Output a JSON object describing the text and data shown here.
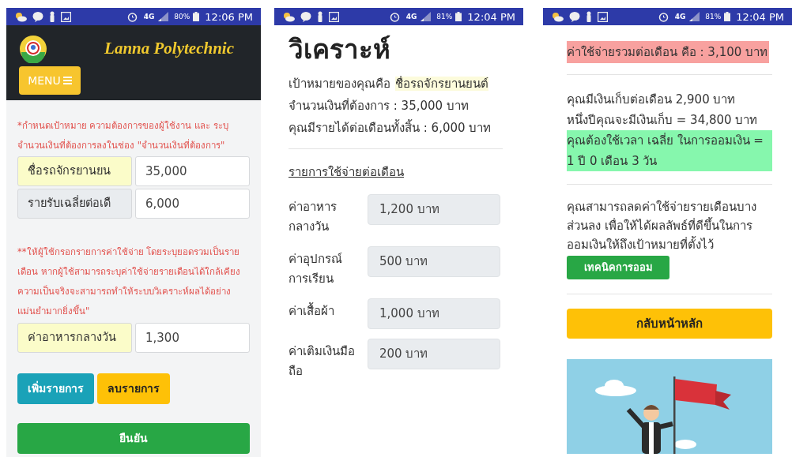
{
  "left_screen": {
    "status_bar": {
      "network": "4G",
      "battery": "80%",
      "time": "12:06 PM"
    },
    "header": {
      "title": "Lanna Polytechnic",
      "menu_button": "MENU"
    },
    "goal_note": "*กำหนดเป้าหมาย ความต้องการของผู้ใช้งาน และ ระบุจำนวนเงินที่ต้องการลงในช่อง \"จำนวนเงินที่ต้องการ\"",
    "goal_inputs": [
      {
        "kind": "highlight",
        "label": "ชื่อรถจักรยานยน",
        "value": "35,000"
      },
      {
        "kind": "plain",
        "label": "รายรับเฉลี่ยต่อเดื",
        "value": "6,000"
      }
    ],
    "expense_note": "**ให้ผู้ใช้กรอกรายการค่าใช้จ่าย โดยระบุยอดรวมเป็นรายเดือน หากผู้ใช้สามารถระบุค่าใช้จ่ายรายเดือนได้ใกล้เคียงความเป็นจริงจะสามารถทำให้ระบบวิเคราะห์ผลได้อย่างแม่นยำมากยิ่งขึ้น\"",
    "expense_inputs": [
      {
        "kind": "highlight",
        "label": "ค่าอาหารกลางวัน",
        "value": "1,300"
      }
    ],
    "buttons": [
      {
        "kind": "add",
        "label": "เพิ่มรายการ"
      },
      {
        "kind": "remove",
        "label": "ลบรายการ"
      }
    ],
    "confirm_button": "ยืนยัน"
  },
  "middle_screen": {
    "status_bar": {
      "network": "4G",
      "battery": "81%",
      "time": "12:04 PM"
    },
    "heading": "วิเคราะห์",
    "goal_label": "เป้าหมายของคุณคือ",
    "goal_value": "ชื่อรถจักรยานยนต์",
    "target_amount": "จำนวนเงินที่ต้องการ : 35,000 บาท",
    "income": "คุณมีรายได้ต่อเดือนทั้งสิ้น : 6,000 บาท",
    "expenses_title": "รายการใช้จ่ายต่อเดือน",
    "expenses": [
      {
        "label": "ค่าอาหารกลางวัน",
        "value": "1,200 บาท"
      },
      {
        "label": "ค่าอุปกรณ์การเรียน",
        "value": "500 บาท"
      },
      {
        "label": "ค่าเสื้อผ้า",
        "value": "1,000 บาท"
      },
      {
        "label": "ค่าเติมเงินมือถือ",
        "value": "200 บาท"
      }
    ]
  },
  "right_screen": {
    "status_bar": {
      "network": "4G",
      "battery": "81%",
      "time": "12:04 PM"
    },
    "total_expense": "ค่าใช้จ่ายรวมต่อเดือน คือ : 3,100 บาท",
    "monthly_savings": "คุณมีเงินเก็บต่อเดือน 2,900 บาท",
    "yearly_savings": "หนึ่งปีคุณจะมีเงินเก็บ = 34,800 บาท",
    "time_needed": "คุณต้องใช้เวลา เฉลี่ย ในการออมเงิน = 1 ปี 0 เดือน 3 วัน",
    "advice": "คุณสามารถลดค่าใช้จ่ายรายเดือนบางส่วนลง เพื่อให้ได้ผลลัพธ์ที่ดีขึ้นในการออมเงินให้ถึงเป้าหมายที่ตั้งไว้",
    "tips_button": "เทคนิคการออม",
    "home_button": "กลับหน้าหลัก"
  }
}
